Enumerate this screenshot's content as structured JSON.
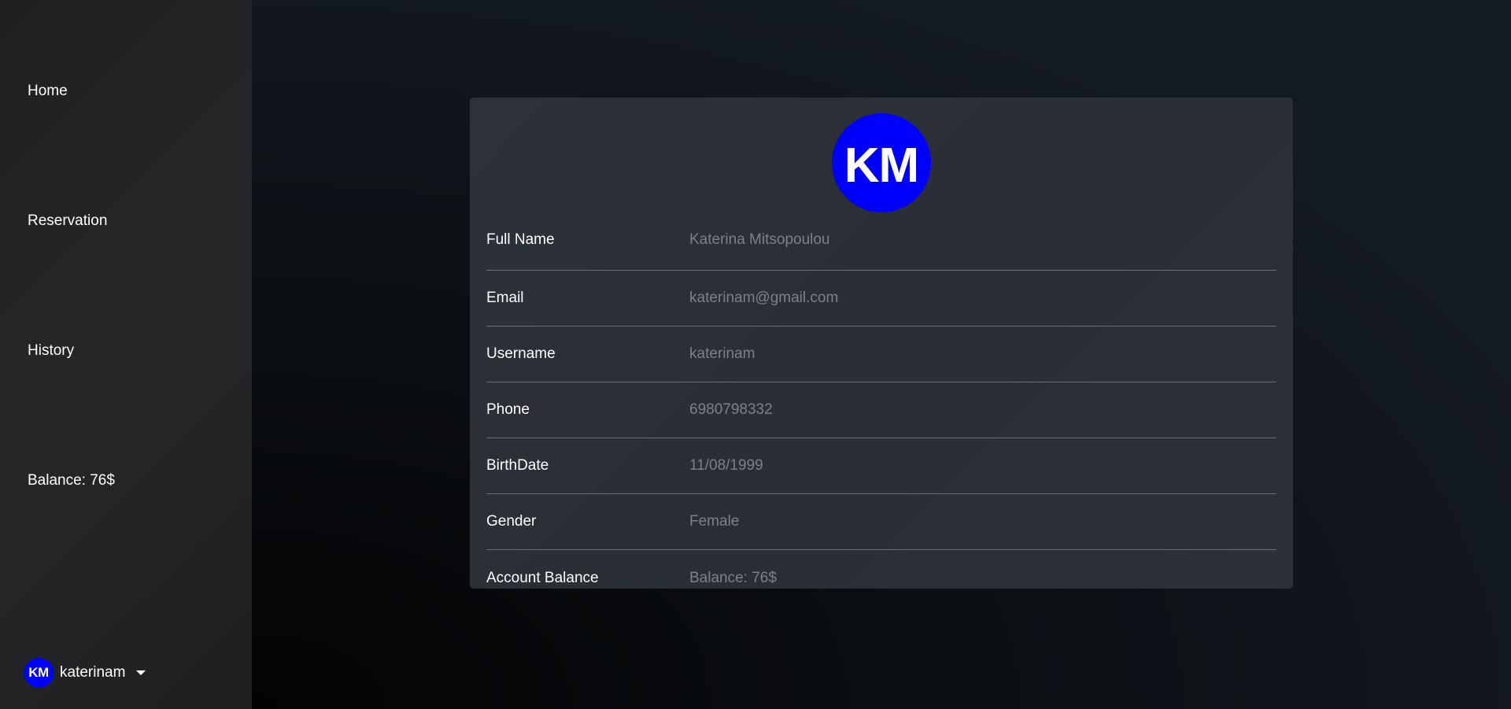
{
  "sidebar": {
    "items": [
      {
        "label": "Home"
      },
      {
        "label": "Reservation"
      },
      {
        "label": "History"
      }
    ],
    "balance": "Balance: 76$",
    "user": {
      "initials": "KM",
      "username": "katerinam"
    }
  },
  "profile": {
    "avatar_initials": "KM",
    "rows": [
      {
        "label": "Full Name",
        "value": "Katerina Mitsopoulou"
      },
      {
        "label": "Email",
        "value": "katerinam@gmail.com"
      },
      {
        "label": "Username",
        "value": "katerinam"
      },
      {
        "label": "Phone",
        "value": "6980798332"
      },
      {
        "label": "BirthDate",
        "value": "11/08/1999"
      },
      {
        "label": "Gender",
        "value": "Female"
      },
      {
        "label": "Account Balance",
        "value": "Balance: 76$"
      }
    ]
  },
  "colors": {
    "avatar": "#0000ff",
    "sidebar_bg": "#242526",
    "card_bg": "#2c3037",
    "value_text": "#7d8187"
  },
  "icons": {
    "user_menu_caret": "caret-down-icon"
  }
}
